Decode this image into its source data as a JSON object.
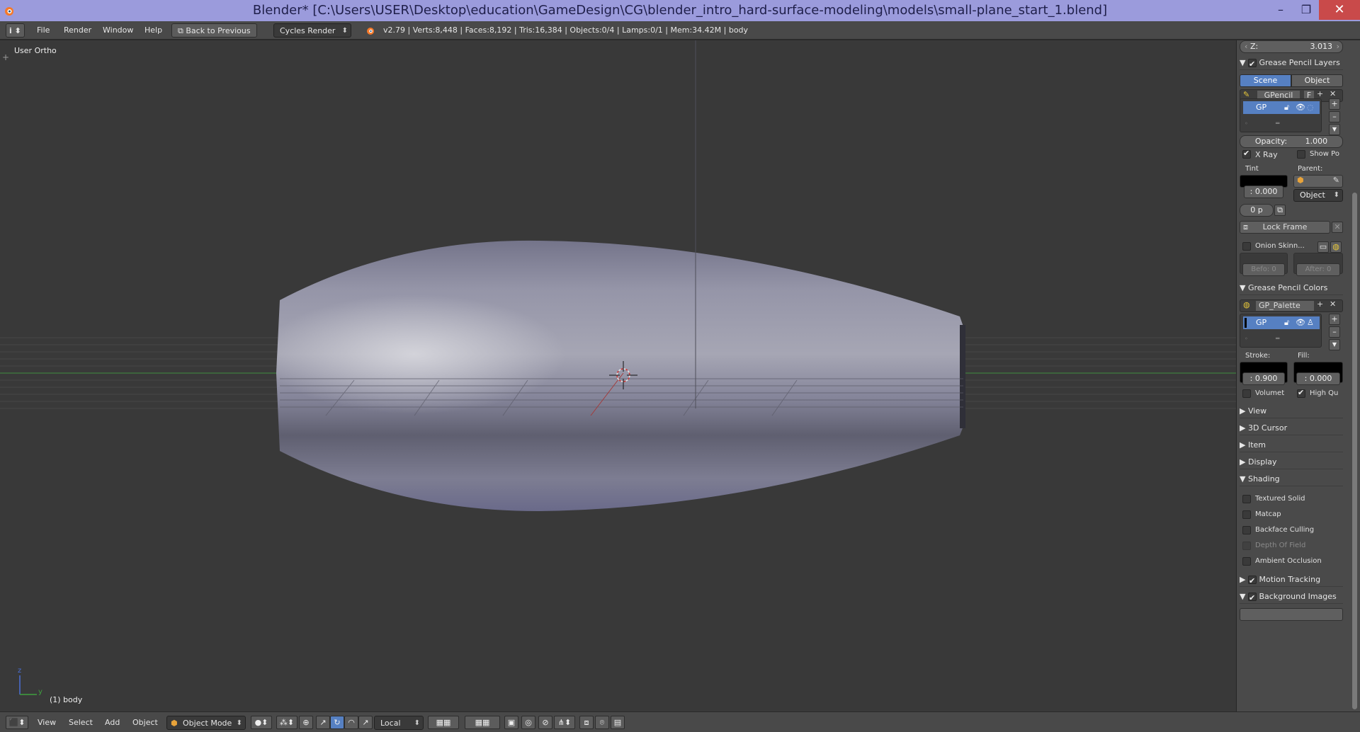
{
  "window": {
    "title": "Blender* [C:\\Users\\USER\\Desktop\\education\\GameDesign\\CG\\blender_intro_hard-surface-modeling\\models\\small-plane_start_1.blend]",
    "minimize": "–",
    "maximize": "❐",
    "close": "✕"
  },
  "topbar": {
    "info_icon": "i",
    "menus": [
      "File",
      "Render",
      "Window",
      "Help"
    ],
    "back_button": "Back to Previous",
    "render_engine": "Cycles Render",
    "stats": "v2.79 | Verts:8,448 | Faces:8,192 | Tris:16,384 | Objects:0/4 | Lamps:0/1 | Mem:34.42M | body"
  },
  "viewport": {
    "view_label": "User Ortho",
    "object_label": "(1) body",
    "axis_x": "y",
    "axis_z": "z",
    "colors": {
      "background": "#393939",
      "grid_x_axis": "#3f8f3f",
      "grid_y_axis": "#a33a3a",
      "mesh": "#8f8fa3"
    }
  },
  "sidebar": {
    "z_field": {
      "label": "Z:",
      "value": "3.013"
    },
    "grease_pencil_layers": {
      "header": "Grease Pencil Layers",
      "tabs": [
        "Scene",
        "Object"
      ],
      "datablock": "GPencil",
      "fake_user": "F",
      "layer_name": "GP",
      "opacity_label": "Opacity:",
      "opacity_value": "1.000",
      "xray": "X Ray",
      "show_points": "Show Po",
      "tint_label": "Tint",
      "tint_value": ": 0.000",
      "parent_label": "Parent:",
      "parent_type": "Object",
      "thickness": "0 p",
      "lock_frame": "Lock Frame",
      "onion_skinning": "Onion Skinn...",
      "before": "Befo: 0",
      "after": "After: 0"
    },
    "grease_pencil_colors": {
      "header": "Grease Pencil Colors",
      "palette": "GP_Palette",
      "color_name": "GP",
      "stroke_label": "Stroke:",
      "stroke_value": ": 0.900",
      "fill_label": "Fill:",
      "fill_value": ": 0.000",
      "volumetric": "Volumet",
      "high_quality": "High Qu"
    },
    "panels_collapsed": [
      "View",
      "3D Cursor",
      "Item",
      "Display"
    ],
    "shading": {
      "header": "Shading",
      "options": [
        "Textured Solid",
        "Matcap",
        "Backface Culling",
        "Depth Of Field",
        "Ambient Occlusion"
      ]
    },
    "motion_tracking": "Motion Tracking",
    "background_images": "Background Images"
  },
  "bottombar": {
    "menus": [
      "View",
      "Select",
      "Add",
      "Object"
    ],
    "mode": "Object Mode",
    "pivot": "Local"
  }
}
